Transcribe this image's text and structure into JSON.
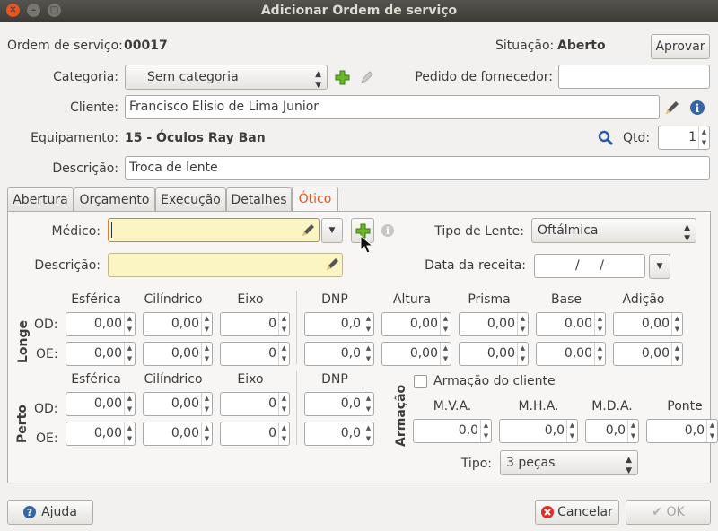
{
  "window": {
    "title": "Adicionar Ordem de serviço"
  },
  "header": {
    "order_label": "Ordem de serviço:",
    "order_value": "00017",
    "status_label": "Situação:",
    "status_value": "Aberto",
    "approve_button": "Aprovar",
    "category_label": "Categoria:",
    "category_value": "Sem categoria",
    "supplier_order_label": "Pedido de fornecedor:",
    "supplier_order_value": "",
    "client_label": "Cliente:",
    "client_value": "Francisco Elisio de Lima Junior",
    "equipment_label": "Equipamento:",
    "equipment_value": "15 - Óculos Ray Ban",
    "qty_label": "Qtd:",
    "qty_value": "1",
    "description_label": "Descrição:",
    "description_value": "Troca de lente"
  },
  "tabs": [
    "Abertura",
    "Orçamento",
    "Execução",
    "Detalhes",
    "Ótico"
  ],
  "optic": {
    "doctor_label": "Médico:",
    "doctor_value": "",
    "lens_type_label": "Tipo de Lente:",
    "lens_type_value": "Oftálmica",
    "description_label": "Descrição:",
    "description_value": "",
    "receipt_date_label": "Data da receita:",
    "receipt_date_value": "/ /",
    "col_headers": [
      "Esférica",
      "Cilíndrico",
      "Eixo",
      "DNP",
      "Altura",
      "Prisma",
      "Base",
      "Adição"
    ],
    "near_headers": [
      "Esférica",
      "Cilíndrico",
      "Eixo",
      "DNP"
    ],
    "far_label": "Longe",
    "near_label": "Perto",
    "od_label": "OD:",
    "oe_label": "OE:",
    "far_od": [
      "0,00",
      "0,00",
      "0",
      "0,0",
      "0,00",
      "0,00",
      "0,00",
      "0,00"
    ],
    "far_oe": [
      "0,00",
      "0,00",
      "0",
      "0,0",
      "0,00",
      "0,00",
      "0,00",
      "0,00"
    ],
    "near_od": [
      "0,00",
      "0,00",
      "0",
      "0,0"
    ],
    "near_oe": [
      "0,00",
      "0,00",
      "0",
      "0,0"
    ],
    "frame_section_label": "Armação",
    "client_frame_label": "Armação do cliente",
    "client_frame_checked": false,
    "frame_headers": [
      "M.V.A.",
      "M.H.A.",
      "M.D.A.",
      "Ponte"
    ],
    "frame_values": [
      "0,0",
      "0,0",
      "0,0",
      "0,0"
    ],
    "type_label": "Tipo:",
    "type_value": "3 peças"
  },
  "footer": {
    "help_button": "Ajuda",
    "cancel_button": "Cancelar",
    "ok_button": "OK"
  },
  "colors": {
    "accent": "#e95420",
    "add_green": "#6bb82a",
    "info_blue": "#3465a4",
    "field_yellow": "#fbf5c3"
  }
}
